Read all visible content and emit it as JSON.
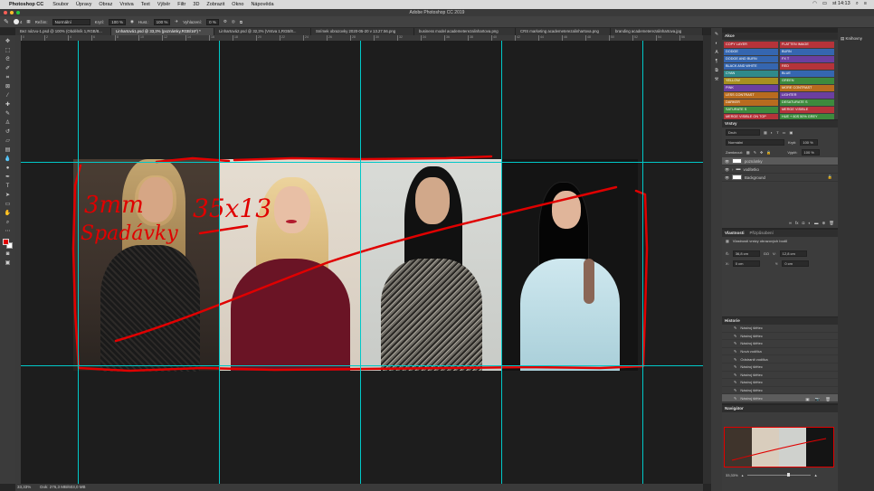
{
  "menubar": {
    "app": "Photoshop CC",
    "items": [
      "Soubor",
      "Úpravy",
      "Obraz",
      "Vrstva",
      "Text",
      "Výběr",
      "Filtr",
      "3D",
      "Zobrazit",
      "Okno",
      "Nápověda"
    ],
    "clock": "st 14:13"
  },
  "window_title": "Adobe Photoshop CC 2019",
  "options": {
    "mode_label": "Režim:",
    "mode_value": "Normální",
    "opacity_label": "Krytí:",
    "opacity_value": "100 %",
    "flow_label": "Hust.:",
    "flow_value": "100 %",
    "smoothing_label": "Vyhlazení:",
    "smoothing_value": "0 %",
    "brush_size": "4"
  },
  "tabs": [
    "Bez názvu-1.psd @ 100% (Obdélník 1,RGB/8...",
    "Linhartová1.psd @ 33,3% (poznámky,RGB/16*) *",
    "Linhartová2.psd @ 32,3% (Vrstva 1,RGB/8...",
    "Snímek obrazovky 2020-05-20 v 13.27.56.png",
    "business model academeterezalinhartova.png",
    "CRS marketing academeterezalinhartova.png",
    "branding academeterezalinhartova.jpg"
  ],
  "ruler_ticks": [
    "0",
    "2",
    "4",
    "6",
    "8",
    "10",
    "12",
    "14",
    "16",
    "18",
    "20",
    "22",
    "24",
    "26",
    "28",
    "30",
    "32",
    "34",
    "36",
    "38",
    "40",
    "42",
    "44",
    "46",
    "48",
    "50",
    "52",
    "54",
    "56",
    "58"
  ],
  "annotations": [
    "3mm",
    "Spadávky",
    "35x13"
  ],
  "status": {
    "zoom": "33,33%",
    "doc": "Dok: 276,3 MB/603,0 MB"
  },
  "actions_panel": {
    "title": "Akce",
    "items": [
      {
        "label": "COPY LAYER",
        "color": "#b5333a"
      },
      {
        "label": "FLATTEN IMAGE",
        "color": "#b5333a"
      },
      {
        "label": "DODGE",
        "color": "#3566b0"
      },
      {
        "label": "BURN",
        "color": "#3566b0"
      },
      {
        "label": "DODGE AND BURN",
        "color": "#3566b0"
      },
      {
        "label": "FX T",
        "color": "#6b3fa0"
      },
      {
        "label": "BLACK AND WHITE",
        "color": "#3566b0"
      },
      {
        "label": "RED",
        "color": "#b5333a"
      },
      {
        "label": "CYAN",
        "color": "#2f8a8a"
      },
      {
        "label": "BLUE",
        "color": "#3566b0"
      },
      {
        "label": "YELLOW",
        "color": "#a8901f"
      },
      {
        "label": "GREEN",
        "color": "#3d8a3d"
      },
      {
        "label": "PINK",
        "color": "#6b3fa0"
      },
      {
        "label": "MORE CONTRAST",
        "color": "#b86b1f"
      },
      {
        "label": "LESS CONTRAST",
        "color": "#b86b1f"
      },
      {
        "label": "LIGHTER",
        "color": "#6b3fa0"
      },
      {
        "label": "DARKER",
        "color": "#b86b1f"
      },
      {
        "label": "DESATURATE S",
        "color": "#3d8a3d"
      },
      {
        "label": "SATURATE S",
        "color": "#3d8a3d"
      },
      {
        "label": "MERGE VISIBLE",
        "color": "#b5333a"
      },
      {
        "label": "MERGE VISIBLE ON TOP",
        "color": "#b5333a"
      },
      {
        "label": "HUE + 60S 50% GREY",
        "color": "#3d8a3d"
      }
    ]
  },
  "layers_panel": {
    "title": "Vrstvy",
    "kind": "Druh",
    "blend": "Normální",
    "opacity_label": "Krytí:",
    "opacity": "100 %",
    "lock_label": "Zamknout:",
    "fill_label": "Výplň:",
    "fill": "100 %",
    "layers": [
      {
        "name": "poznámky",
        "selected": true,
        "type": "layer"
      },
      {
        "name": "vodítetko",
        "selected": false,
        "type": "folder"
      },
      {
        "name": "Background",
        "selected": false,
        "type": "bg"
      }
    ]
  },
  "properties_panel": {
    "title": "Vlastnosti",
    "tab2": "Přizpůsobení",
    "subtitle": "Vlastnosti vrstvy obrazových bodů",
    "w_label": "Š:",
    "w": "36,8 cm",
    "go": "GO",
    "v_label": "V:",
    "v": "12,8 cm",
    "x_label": "X:",
    "x": "0 cm",
    "y_label": "Y:",
    "y": "0 cm"
  },
  "history_panel": {
    "title": "Historie",
    "items": [
      "Nástroj štětec",
      "Nástroj štětec",
      "Nástroj štětec",
      "Nová vodítka",
      "Odstranit vodítka",
      "Nástroj štětec",
      "Nástroj štětec",
      "Nástroj štětec",
      "Nástroj štětec",
      "Nástroj štětec"
    ]
  },
  "navigator_panel": {
    "title": "Navigátor",
    "zoom": "33,33%"
  },
  "libraries_tab": "Knihovny"
}
